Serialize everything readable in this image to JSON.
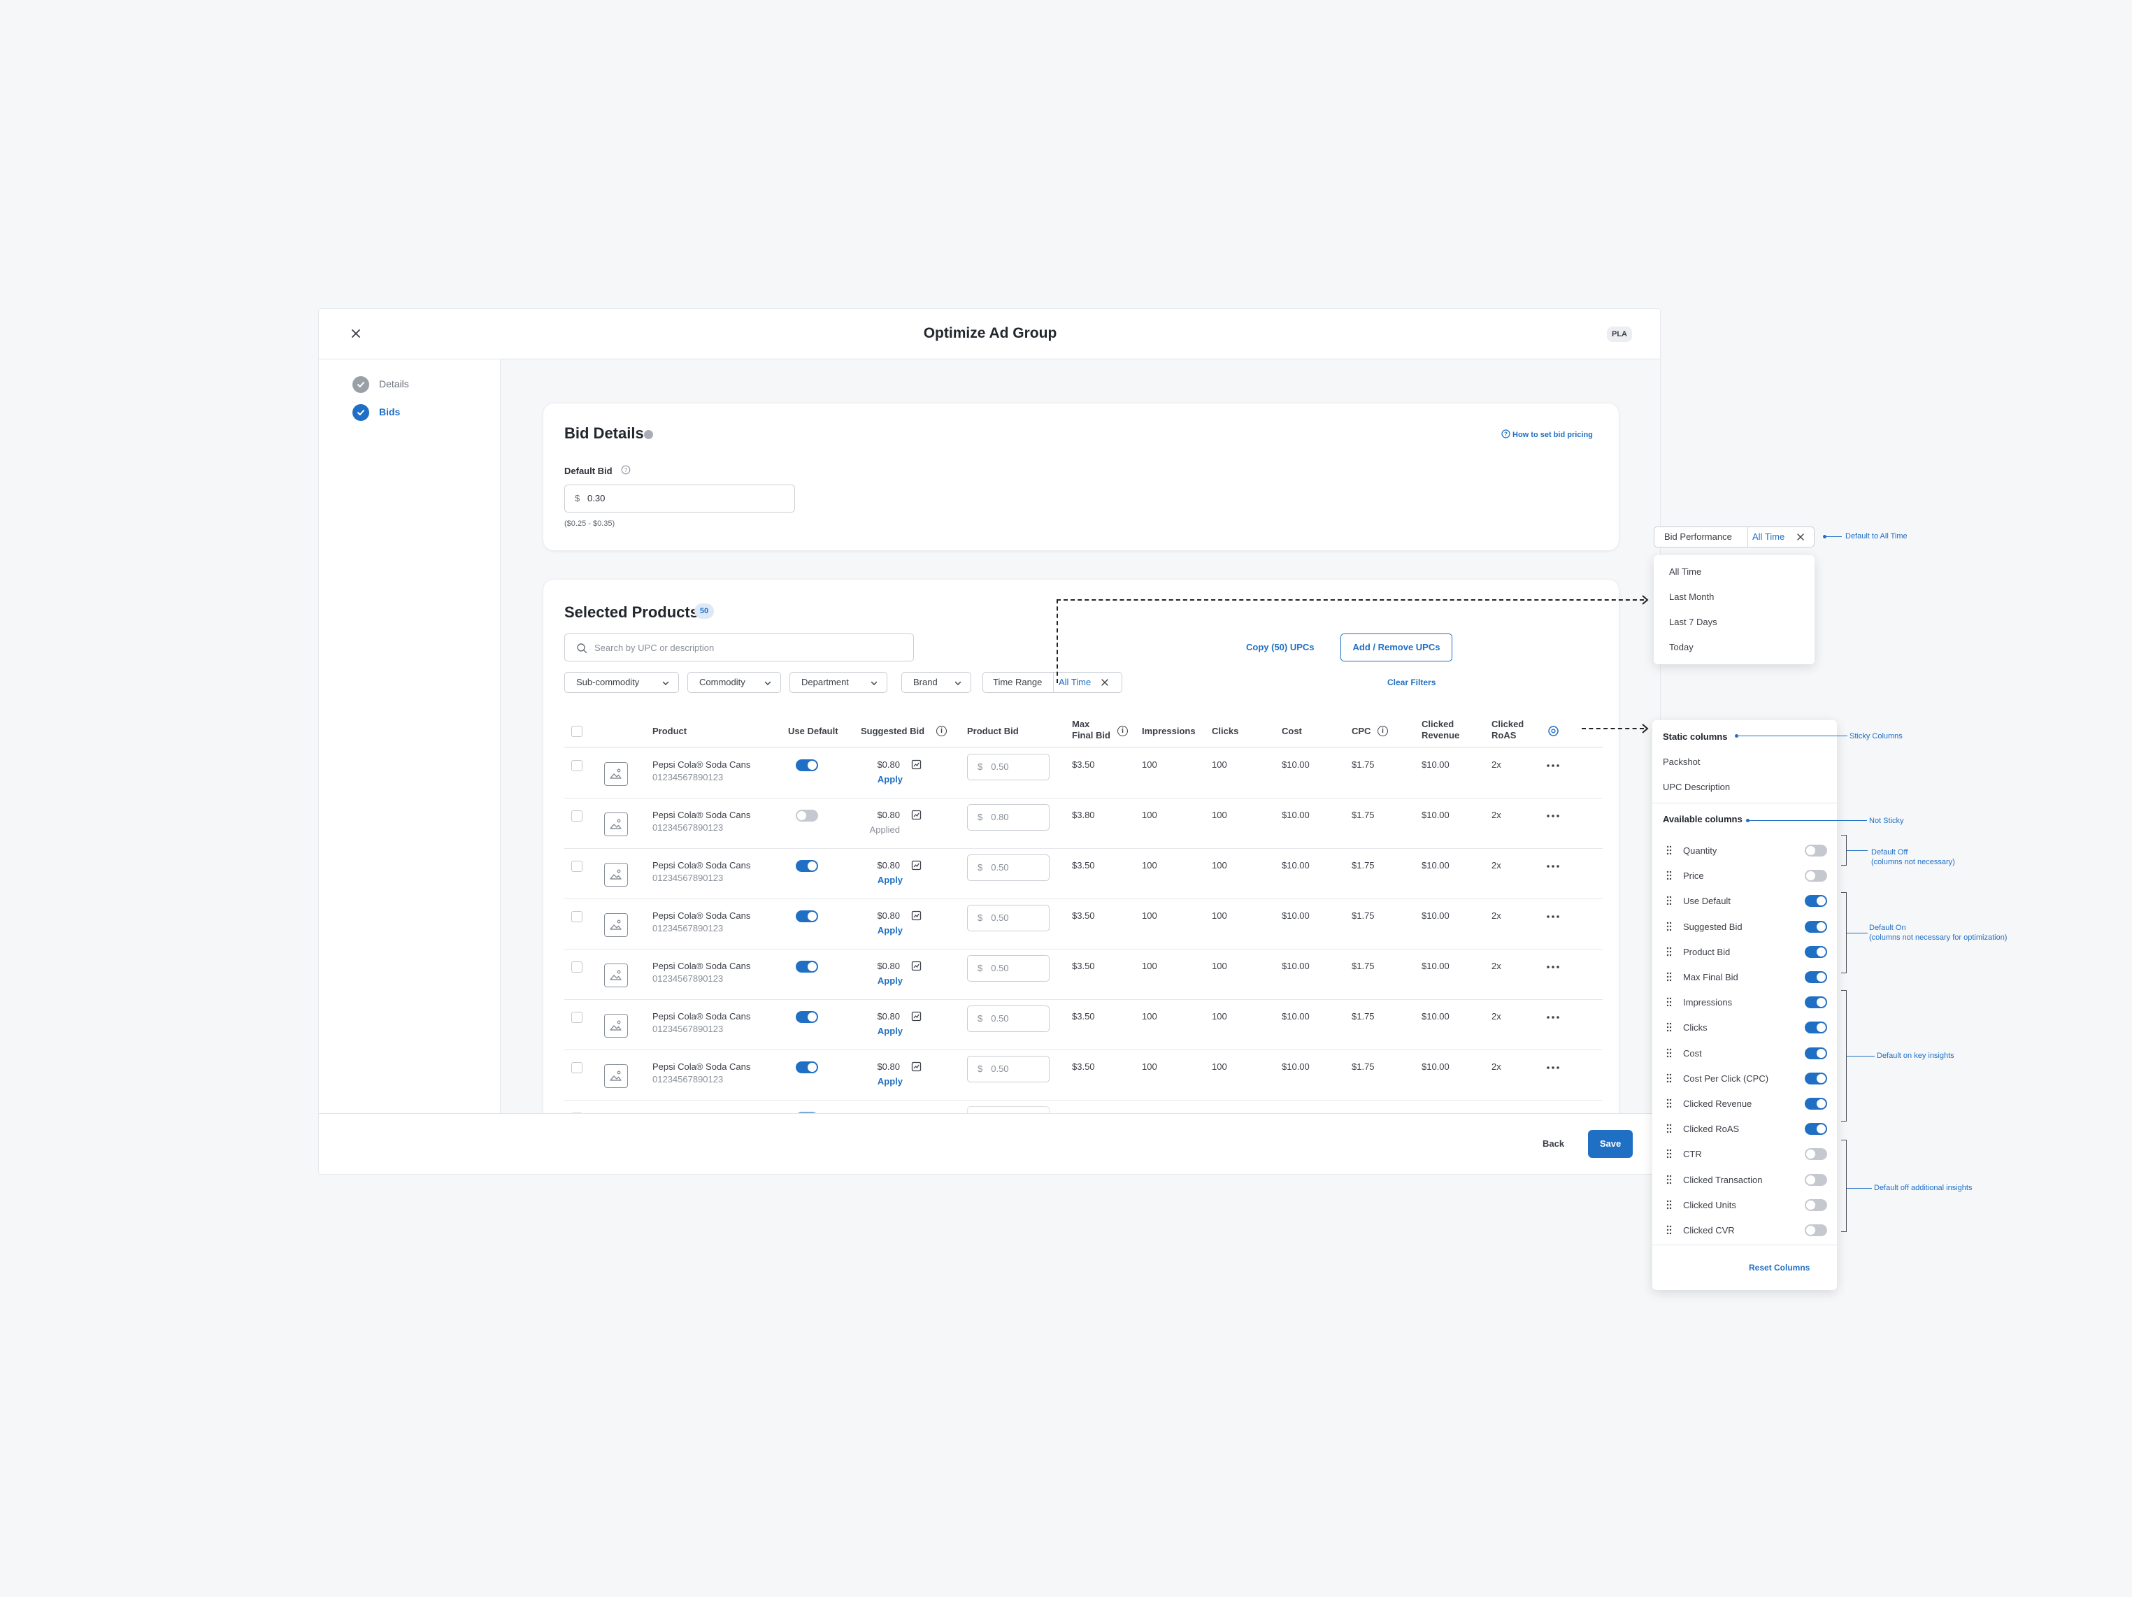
{
  "modal": {
    "title": "Optimize Ad Group",
    "badge": "PLA",
    "steps": [
      {
        "label": "Details",
        "state": "completed"
      },
      {
        "label": "Bids",
        "state": "active"
      }
    ]
  },
  "bid_details": {
    "title": "Bid Details",
    "help_link": "How to set bid pricing",
    "default_bid_label": "Default Bid",
    "currency": "$",
    "default_bid_value": "0.30",
    "range": "($0.25 - $0.35)"
  },
  "selected_products": {
    "title": "Selected Products",
    "count": "50",
    "search_placeholder": "Search by UPC or description",
    "copy_button": "Copy (50) UPCs",
    "add_remove_button": "Add / Remove UPCs",
    "filters": [
      "Sub-commodity",
      "Commodity",
      "Department",
      "Brand"
    ],
    "time_range_label": "Time Range",
    "time_range_value": "All Time",
    "clear_filters": "Clear Filters",
    "columns": {
      "product": "Product",
      "use_default": "Use Default",
      "suggested_bid": "Suggested Bid",
      "product_bid": "Product Bid",
      "max_final_bid_1": "Max",
      "max_final_bid_2": "Final Bid",
      "impressions": "Impressions",
      "clicks": "Clicks",
      "cost": "Cost",
      "cpc": "CPC",
      "clicked_revenue_1": "Clicked",
      "clicked_revenue_2": "Revenue",
      "clicked_roas_1": "Clicked",
      "clicked_roas_2": "RoAS"
    },
    "rows": [
      {
        "name": "Pepsi Cola® Soda Cans",
        "upc": "01234567890123",
        "use_default": true,
        "suggested": "$0.80",
        "action": "Apply",
        "currency": "$",
        "bid": "0.50",
        "max_final": "$3.50",
        "impressions": "100",
        "clicks": "100",
        "cost": "$10.00",
        "cpc": "$1.75",
        "revenue": "$10.00",
        "roas": "2x"
      },
      {
        "name": "Pepsi Cola® Soda Cans",
        "upc": "01234567890123",
        "use_default": false,
        "suggested": "$0.80",
        "action": "Applied",
        "currency": "$",
        "bid": "0.80",
        "max_final": "$3.80",
        "impressions": "100",
        "clicks": "100",
        "cost": "$10.00",
        "cpc": "$1.75",
        "revenue": "$10.00",
        "roas": "2x"
      },
      {
        "name": "Pepsi Cola® Soda Cans",
        "upc": "01234567890123",
        "use_default": true,
        "suggested": "$0.80",
        "action": "Apply",
        "currency": "$",
        "bid": "0.50",
        "max_final": "$3.50",
        "impressions": "100",
        "clicks": "100",
        "cost": "$10.00",
        "cpc": "$1.75",
        "revenue": "$10.00",
        "roas": "2x"
      },
      {
        "name": "Pepsi Cola® Soda Cans",
        "upc": "01234567890123",
        "use_default": true,
        "suggested": "$0.80",
        "action": "Apply",
        "currency": "$",
        "bid": "0.50",
        "max_final": "$3.50",
        "impressions": "100",
        "clicks": "100",
        "cost": "$10.00",
        "cpc": "$1.75",
        "revenue": "$10.00",
        "roas": "2x"
      },
      {
        "name": "Pepsi Cola® Soda Cans",
        "upc": "01234567890123",
        "use_default": true,
        "suggested": "$0.80",
        "action": "Apply",
        "currency": "$",
        "bid": "0.50",
        "max_final": "$3.50",
        "impressions": "100",
        "clicks": "100",
        "cost": "$10.00",
        "cpc": "$1.75",
        "revenue": "$10.00",
        "roas": "2x"
      },
      {
        "name": "Pepsi Cola® Soda Cans",
        "upc": "01234567890123",
        "use_default": true,
        "suggested": "$0.80",
        "action": "Apply",
        "currency": "$",
        "bid": "0.50",
        "max_final": "$3.50",
        "impressions": "100",
        "clicks": "100",
        "cost": "$10.00",
        "cpc": "$1.75",
        "revenue": "$10.00",
        "roas": "2x"
      },
      {
        "name": "Pepsi Cola® Soda Cans",
        "upc": "01234567890123",
        "use_default": true,
        "suggested": "$0.80",
        "action": "Apply",
        "currency": "$",
        "bid": "0.50",
        "max_final": "$3.50",
        "impressions": "100",
        "clicks": "100",
        "cost": "$10.00",
        "cpc": "$1.75",
        "revenue": "$10.00",
        "roas": "2x"
      }
    ]
  },
  "footer": {
    "back": "Back",
    "save": "Save"
  },
  "bid_performance": {
    "label": "Bid Performance",
    "value": "All Time",
    "options": [
      "All Time",
      "Last Month",
      "Last 7 Days",
      "Today"
    ],
    "annotation": "Default to All Time"
  },
  "column_panel": {
    "static_title": "Static columns",
    "static_items": [
      "Packshot",
      "UPC Description"
    ],
    "available_title": "Available columns",
    "items": [
      {
        "label": "Quantity",
        "on": false
      },
      {
        "label": "Price",
        "on": false
      },
      {
        "label": "Use Default",
        "on": true
      },
      {
        "label": "Suggested Bid",
        "on": true
      },
      {
        "label": "Product Bid",
        "on": true
      },
      {
        "label": "Max Final Bid",
        "on": true
      },
      {
        "label": "Impressions",
        "on": true
      },
      {
        "label": "Clicks",
        "on": true
      },
      {
        "label": "Cost",
        "on": true
      },
      {
        "label": "Cost Per Click (CPC)",
        "on": true
      },
      {
        "label": "Clicked Revenue",
        "on": true
      },
      {
        "label": "Clicked RoAS",
        "on": true
      },
      {
        "label": "CTR",
        "on": false
      },
      {
        "label": "Clicked Transaction",
        "on": false
      },
      {
        "label": "Clicked Units",
        "on": false
      },
      {
        "label": "Clicked CVR",
        "on": false
      }
    ],
    "reset": "Reset Columns"
  },
  "annotations": {
    "sticky": "Sticky Columns",
    "not_sticky": "Not Sticky",
    "default_off_1": "Default Off",
    "default_off_2": "(columns not necessary)",
    "default_on_1": "Default On",
    "default_on_2": "(columns not necessary for optimization)",
    "key_insights": "Default on key insights",
    "additional": "Default off additional insights"
  },
  "colors": {
    "accent": "#1f6fc4",
    "toggle_off": "#c5c9cf"
  }
}
